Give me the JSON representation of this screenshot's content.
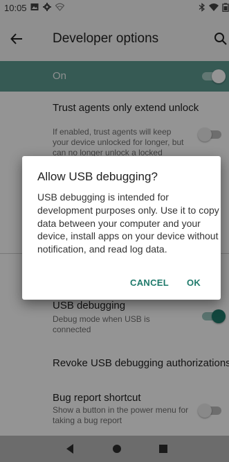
{
  "status_bar": {
    "time": "10:05"
  },
  "app_bar": {
    "title": "Developer options"
  },
  "master_switch": {
    "label": "On",
    "checked": true
  },
  "settings": {
    "trust_agents": {
      "title": "Trust agents only extend unlock",
      "summary": "If enabled, trust agents will keep your device unlocked for longer, but can no longer unlock a locked",
      "checked": false
    },
    "usb_debugging": {
      "title": "USB debugging",
      "summary": "Debug mode when USB is connected",
      "checked": true
    },
    "revoke": {
      "title": "Revoke USB debugging authorizations"
    },
    "bug_report": {
      "title": "Bug report shortcut",
      "summary": "Show a button in the power menu for taking a bug report",
      "checked": false
    }
  },
  "dialog": {
    "title": "Allow USB debugging?",
    "message": "USB debugging is intended for development purposes only. Use it to copy data between your computer and your device, install apps on your device without notification, and read log data.",
    "cancel_label": "CANCEL",
    "ok_label": "OK"
  },
  "colors": {
    "accent": "#1f7a6b",
    "master_row_bg": "#5d9b92",
    "nav_bar_bg": "#6c6c6c"
  },
  "icons": {
    "status": [
      "image-icon",
      "gear-icon",
      "wifi-off-icon",
      "bluetooth-icon",
      "wifi-icon",
      "battery-icon"
    ],
    "app_bar": [
      "back-arrow-icon",
      "search-icon"
    ],
    "nav": [
      "nav-back-icon",
      "nav-home-icon",
      "nav-recents-icon"
    ]
  }
}
